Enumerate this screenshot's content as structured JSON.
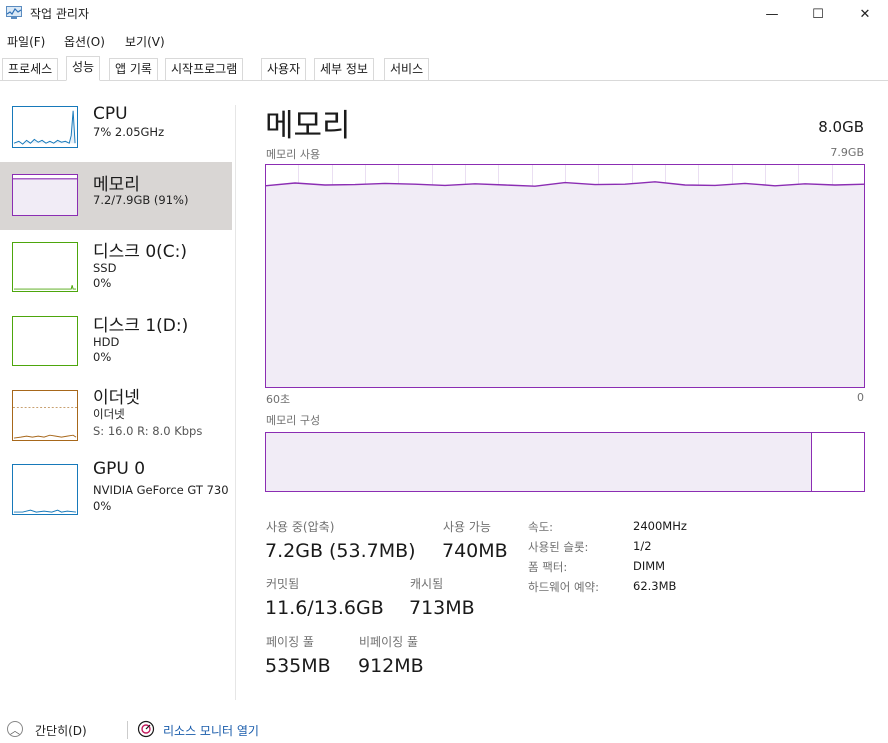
{
  "window": {
    "title": "작업 관리자",
    "minimize_glyph": "—",
    "maximize_glyph": "☐",
    "close_glyph": "✕",
    "app_icon": "task-manager-icon"
  },
  "menu": [
    "파일(F)",
    "옵션(O)",
    "보기(V)"
  ],
  "tabs": [
    "프로세스",
    "성능",
    "앱 기록",
    "시작프로그램",
    "사용자",
    "세부 정보",
    "서비스"
  ],
  "active_tab": "성능",
  "sidebar": [
    {
      "title": "CPU",
      "line1": "7% 2.05GHz",
      "line2": "",
      "line3": "",
      "color": "#1779ba"
    },
    {
      "title": "메모리",
      "line1": "7.2/7.9GB (91%)",
      "line2": "",
      "line3": "",
      "color": "#8b2db3"
    },
    {
      "title": "디스크 0(C:)",
      "line1": "SSD",
      "line2": "0%",
      "line3": "",
      "color": "#4da60c"
    },
    {
      "title": "디스크 1(D:)",
      "line1": "HDD",
      "line2": "0%",
      "line3": "",
      "color": "#4da60c"
    },
    {
      "title": "이더넷",
      "line1": "이더넷",
      "line2": "S: 16.0  R: 8.0 Kbps",
      "line3": "",
      "color": "#a7671a"
    },
    {
      "title": "GPU 0",
      "line1": "NVIDIA GeForce GT 730",
      "line2": "0%",
      "line3": "",
      "color": "#1779ba"
    }
  ],
  "main": {
    "title": "메모리",
    "total": "8.0GB",
    "usage_label": "메모리 사용",
    "usage_max": "7.9GB",
    "x_left": "60초",
    "x_right": "0",
    "composition_label": "메모리 구성",
    "usage_percent": 91,
    "accent": "#8b2db3",
    "fill": "#f1ecf6"
  },
  "stats": {
    "in_use_label": "사용 중(압축)",
    "in_use_value": "7.2GB (53.7MB)",
    "available_label": "사용 가능",
    "available_value": "740MB",
    "committed_label": "커밋됨",
    "committed_value": "11.6/13.6GB",
    "cached_label": "캐시됨",
    "cached_value": "713MB",
    "paged_label": "페이징 풀",
    "paged_value": "535MB",
    "nonpaged_label": "비페이징 풀",
    "nonpaged_value": "912MB"
  },
  "specs": [
    {
      "label": "속도:",
      "value": "2400MHz"
    },
    {
      "label": "사용된 슬롯:",
      "value": "1/2"
    },
    {
      "label": "폼 팩터:",
      "value": "DIMM"
    },
    {
      "label": "하드웨어 예약:",
      "value": "62.3MB"
    }
  ],
  "footer": {
    "collapse": "간단히(D)",
    "monitor": "리소스 모니터 열기",
    "collapse_icon": "chevron-up-icon",
    "monitor_icon": "resource-monitor-icon"
  }
}
